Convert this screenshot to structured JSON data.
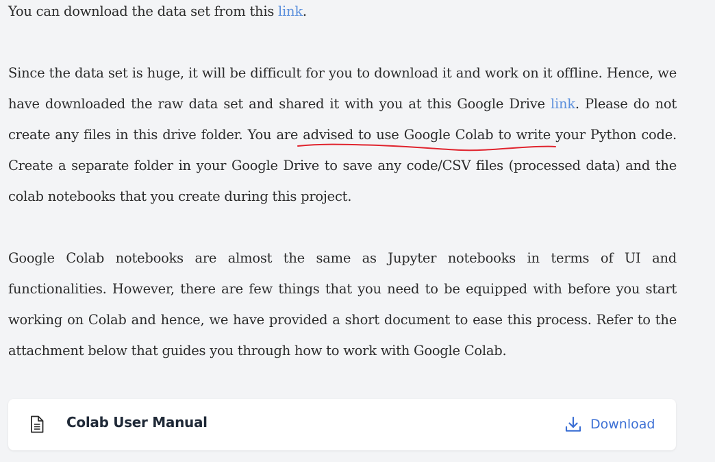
{
  "paragraphs": {
    "p1": {
      "before": "You can download the data set from this ",
      "link": "link",
      "after": "."
    },
    "p2": {
      "part1": "Since the data set is huge, it will be difficult for you to download it and work on it offline. Hence, we have downloaded the raw data set and shared it with you at this Google Drive ",
      "link": "link",
      "part2": ". Please do not create any files in this drive folder. You are advised to use ",
      "underlined": "Google Colab to write your Python code",
      "part3": ". Create a separate folder in your Google Drive to save any code/CSV files (processed data) and the colab notebooks that you create during this project."
    },
    "p3": "Google Colab notebooks are almost the same as Jupyter notebooks in terms of UI and functionalities. However, there are few things that you need to be equipped with before you start working on Colab and hence, we have provided a short document to ease this process. Refer to the attachment below that guides you through how to work with Google Colab."
  },
  "attachment": {
    "title": "Colab User Manual",
    "download_label": "Download",
    "file_icon": "document-icon",
    "download_icon": "download-icon"
  },
  "colors": {
    "link": "#5b8fdc",
    "download": "#3b6fd4",
    "annotation": "#e0242e",
    "background": "#f3f4f6"
  }
}
